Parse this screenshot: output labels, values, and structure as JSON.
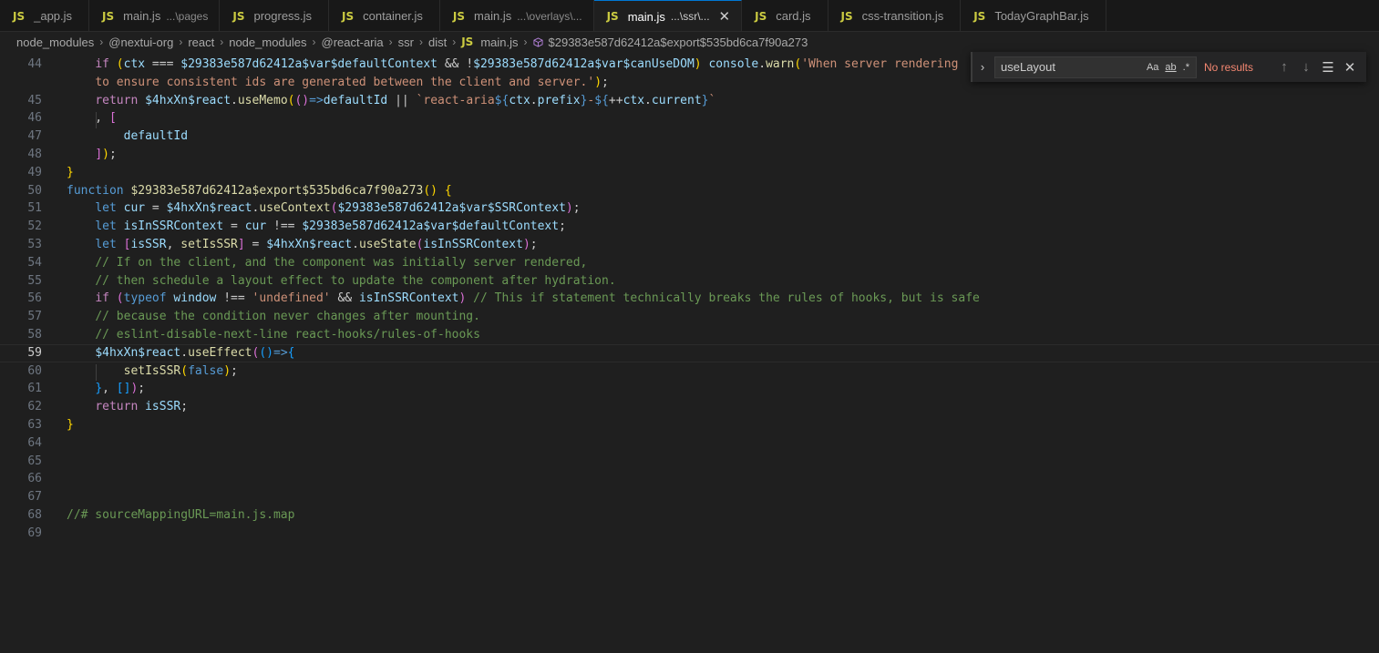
{
  "tabs": [
    {
      "label": "_app.js",
      "desc": "",
      "active": false
    },
    {
      "label": "main.js",
      "desc": "...\\pages",
      "active": false
    },
    {
      "label": "progress.js",
      "desc": "",
      "active": false
    },
    {
      "label": "container.js",
      "desc": "",
      "active": false
    },
    {
      "label": "main.js",
      "desc": "...\\overlays\\...",
      "active": false
    },
    {
      "label": "main.js",
      "desc": "...\\ssr\\...",
      "active": true
    },
    {
      "label": "card.js",
      "desc": "",
      "active": false
    },
    {
      "label": "css-transition.js",
      "desc": "",
      "active": false
    },
    {
      "label": "TodayGraphBar.js",
      "desc": "",
      "active": false
    }
  ],
  "tab_icon_text": "JS",
  "breadcrumb": {
    "items": [
      "node_modules",
      "@nextui-org",
      "react",
      "node_modules",
      "@react-aria",
      "ssr",
      "dist"
    ],
    "file": "main.js",
    "symbol": "$29383e587d62412a$export$535bd6ca7f90a273"
  },
  "find": {
    "value": "useLayout",
    "match_case": "Aa",
    "whole_word": "ab",
    "regex": ".*",
    "status": "No results"
  },
  "editor": {
    "current_line": "59",
    "lines": [
      {
        "n": "44",
        "html": "    <span class=\"ctl\">if</span> <span class=\"br1\">(</span><span class=\"vr\">ctx</span> === <span class=\"vr\">$29383e587d62412a$var$defaultContext</span> &amp;&amp; !<span class=\"vr\">$29383e587d62412a$var$canUseDOM</span><span class=\"br1\">)</span> <span class=\"vr\">console</span>.<span class=\"fn\">warn</span><span class=\"br1\">(</span><span class=\"str\">'When server rendering</span>"
      },
      {
        "n": "",
        "html": "    <span class=\"str\">to ensure consistent ids are generated between the client and server.'</span><span class=\"br1\">)</span>;"
      },
      {
        "n": "45",
        "html": "    <span class=\"ctl\">return</span> <span class=\"vr\">$4hxXn$react</span>.<span class=\"fn\">useMemo</span><span class=\"br1\">(</span><span class=\"br2\">()</span><span class=\"kw\">=&gt;</span><span class=\"vr\">defaultId</span> || <span class=\"str\">`react-aria</span><span class=\"kw\">${</span><span class=\"vr\">ctx</span>.<span class=\"vr\">prefix</span><span class=\"kw\">}</span><span class=\"str\">-</span><span class=\"kw\">${</span>++<span class=\"vr\">ctx</span>.<span class=\"vr\">current</span><span class=\"kw\">}</span><span class=\"str\">`</span>"
      },
      {
        "n": "46",
        "html": "    , <span class=\"br2\">[</span>"
      },
      {
        "n": "47",
        "html": "        <span class=\"vr\">defaultId</span>"
      },
      {
        "n": "48",
        "html": "    <span class=\"br2\">]</span><span class=\"br1\">)</span>;"
      },
      {
        "n": "49",
        "html": "<span class=\"br1\">}</span>"
      },
      {
        "n": "50",
        "html": "<span class=\"kw\">function</span> <span class=\"fn\">$29383e587d62412a$export$535bd6ca7f90a273</span><span class=\"br1\">()</span> <span class=\"br1\">{</span>"
      },
      {
        "n": "51",
        "html": "    <span class=\"kw\">let</span> <span class=\"vr\">cur</span> = <span class=\"vr\">$4hxXn$react</span>.<span class=\"fn\">useContext</span><span class=\"br2\">(</span><span class=\"vr\">$29383e587d62412a$var$SSRContext</span><span class=\"br2\">)</span>;"
      },
      {
        "n": "52",
        "html": "    <span class=\"kw\">let</span> <span class=\"vr\">isInSSRContext</span> = <span class=\"vr\">cur</span> !== <span class=\"vr\">$29383e587d62412a$var$defaultContext</span>;"
      },
      {
        "n": "53",
        "html": "    <span class=\"kw\">let</span> <span class=\"br2\">[</span><span class=\"vr\">isSSR</span>, <span class=\"fn\">setIsSSR</span><span class=\"br2\">]</span> = <span class=\"vr\">$4hxXn$react</span>.<span class=\"fn\">useState</span><span class=\"br2\">(</span><span class=\"vr\">isInSSRContext</span><span class=\"br2\">)</span>;"
      },
      {
        "n": "54",
        "html": "    <span class=\"cmt\">// If on the client, and the component was initially server rendered,</span>"
      },
      {
        "n": "55",
        "html": "    <span class=\"cmt\">// then schedule a layout effect to update the component after hydration.</span>"
      },
      {
        "n": "56",
        "html": "    <span class=\"ctl\">if</span> <span class=\"br2\">(</span><span class=\"kw\">typeof</span> <span class=\"vr\">window</span> !== <span class=\"str\">'undefined'</span> &amp;&amp; <span class=\"vr\">isInSSRContext</span><span class=\"br2\">)</span> <span class=\"cmt\">// This if statement technically breaks the rules of hooks, but is safe</span>"
      },
      {
        "n": "57",
        "html": "    <span class=\"cmt\">// because the condition never changes after mounting.</span>"
      },
      {
        "n": "58",
        "html": "    <span class=\"cmt\">// eslint-disable-next-line react-hooks/rules-of-hooks</span>"
      },
      {
        "n": "59",
        "html": "    <span class=\"vr\">$4hxXn$react</span>.<span class=\"fn\">useEffect</span><span class=\"br2\">(</span><span class=\"br3\">()</span><span class=\"kw\">=&gt;</span><span class=\"br3\">{</span>"
      },
      {
        "n": "60",
        "html": "        <span class=\"fn\">setIsSSR</span><span class=\"br1\">(</span><span class=\"kw\">false</span><span class=\"br1\">)</span>;"
      },
      {
        "n": "61",
        "html": "    <span class=\"br3\">}</span>, <span class=\"br3\">[]</span><span class=\"br2\">)</span>;"
      },
      {
        "n": "62",
        "html": "    <span class=\"ctl\">return</span> <span class=\"vr\">isSSR</span>;"
      },
      {
        "n": "63",
        "html": "<span class=\"br1\">}</span>"
      },
      {
        "n": "64",
        "html": ""
      },
      {
        "n": "65",
        "html": ""
      },
      {
        "n": "66",
        "html": ""
      },
      {
        "n": "67",
        "html": ""
      },
      {
        "n": "68",
        "html": "<span class=\"cmt\">//# sourceMappingURL=main.js.map</span>"
      },
      {
        "n": "69",
        "html": ""
      }
    ]
  }
}
